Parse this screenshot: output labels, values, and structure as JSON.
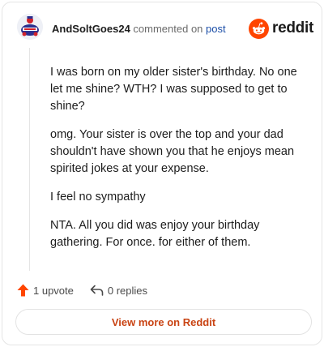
{
  "header": {
    "username": "AndSoltGoes24",
    "action_text": "commented on",
    "post_link": "post",
    "brand_name": "reddit"
  },
  "comment": {
    "paragraphs": [
      "I was born on my older sister's birthday. No one let me shine? WTH? I was supposed to get to shine?",
      "omg. Your sister is over the top and your dad shouldn't have shown you that he enjoys mean spirited jokes at your expense.",
      "I feel no sympathy",
      "NTA. All you did was enjoy your birthday gathering. For once. for either of them."
    ]
  },
  "actions": {
    "upvote_label": "1 upvote",
    "replies_label": "0 replies"
  },
  "view_more_label": "View more on Reddit",
  "colors": {
    "brand_orange": "#ff4500",
    "link_blue": "#1c4fa8",
    "view_more_text": "#c94414"
  }
}
